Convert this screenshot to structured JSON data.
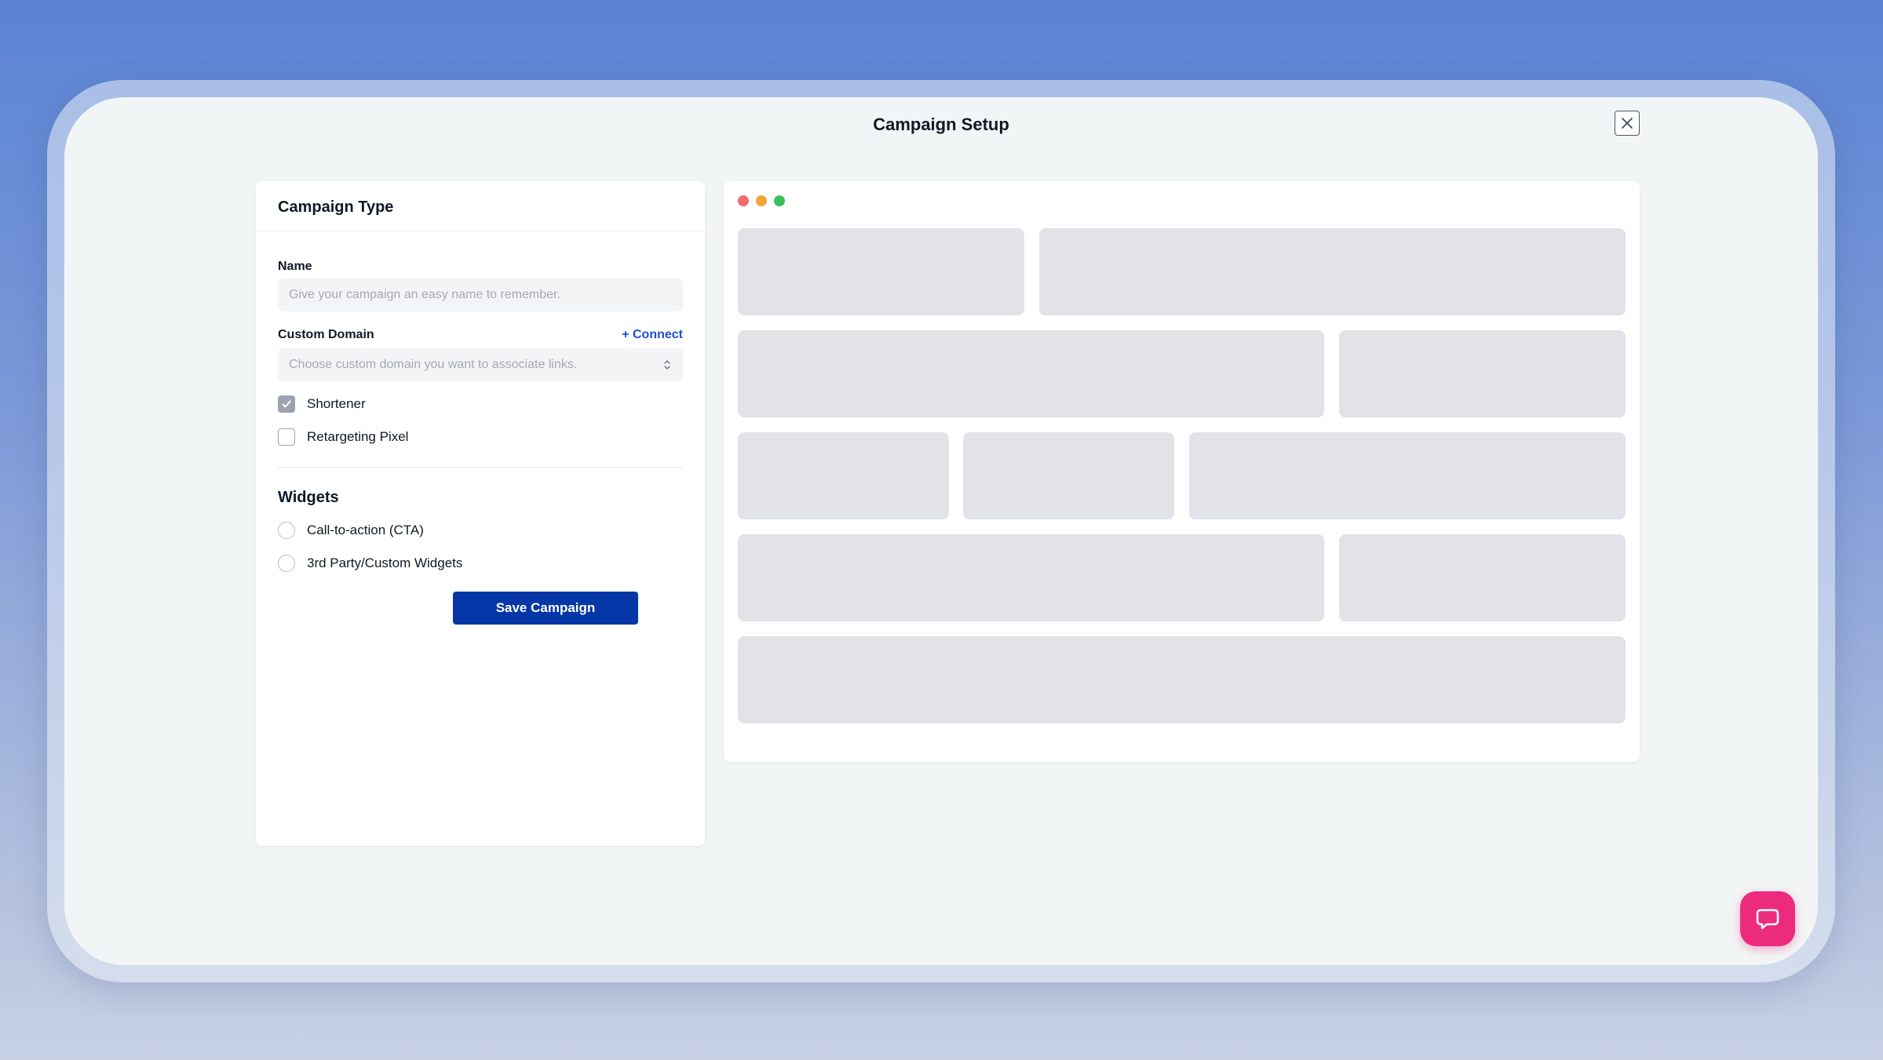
{
  "modal": {
    "title": "Campaign Setup",
    "close_icon": "close-icon"
  },
  "form": {
    "header": "Campaign Type",
    "name_label": "Name",
    "name_placeholder": "Give your campaign an easy name to remember.",
    "name_value": "",
    "domain_label": "Custom Domain",
    "connect_label": "+ Connect",
    "domain_placeholder": "Choose custom domain you want to associate links.",
    "options": [
      {
        "label": "Shortener",
        "checked": true
      },
      {
        "label": "Retargeting Pixel",
        "checked": false
      }
    ],
    "widgets_title": "Widgets",
    "widgets": [
      {
        "label": "Call-to-action (CTA)",
        "selected": false
      },
      {
        "label": "3rd Party/Custom Widgets",
        "selected": false
      }
    ],
    "save_label": "Save Campaign"
  },
  "preview": {
    "window_dots": [
      "#f26b6b",
      "#f5a33a",
      "#3fbf5a"
    ],
    "skeleton_color": "#e1e3e8"
  },
  "chat": {
    "icon": "chat-bubble-icon",
    "color": "#ec2a7e"
  }
}
